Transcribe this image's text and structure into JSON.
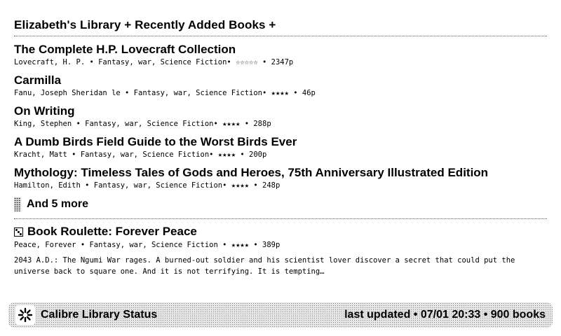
{
  "header": {
    "library": "Elizabeth's Library +",
    "recent": "Recently Added Books +"
  },
  "books": [
    {
      "title": "The Complete H.P. Lovecraft Collection",
      "meta": "Lovecraft, H. P. • Fantasy, war, Science Fiction• ☆☆☆☆☆ • 2347p"
    },
    {
      "title": "Carmilla",
      "meta": "Fanu, Joseph Sheridan le • Fantasy, war, Science Fiction• ★★★★ • 46p"
    },
    {
      "title": "On Writing",
      "meta": "King, Stephen • Fantasy, war, Science Fiction• ★★★★ • 288p"
    },
    {
      "title": "A Dumb Birds Field Guide to the Worst Birds Ever",
      "meta": "Kracht, Matt • Fantasy, war, Science Fiction• ★★★★ • 200p"
    },
    {
      "title": "Mythology: Timeless Tales of Gods and Heroes, 75th Anniversary Illustrated Edition",
      "meta": "Hamilton, Edith • Fantasy, war, Science Fiction• ★★★★ • 248p"
    }
  ],
  "more": {
    "label": "And 5 more"
  },
  "roulette": {
    "icon": "die-icon",
    "title": "Book Roulette: Forever Peace",
    "meta": "Peace, Forever • Fantasy, war, Science Fiction • ★★★★ • 389p",
    "description": "2043 A.D.: The Ngumi War rages. A burned-out soldier and his scientist lover discover a secret that could put the universe back to square one. And it is not terrifying. It is tempting…"
  },
  "status": {
    "icon": "calibre-logo-icon",
    "title": "Calibre Library Status",
    "updated": "last updated • 07/01 20:33 • 900 books"
  }
}
